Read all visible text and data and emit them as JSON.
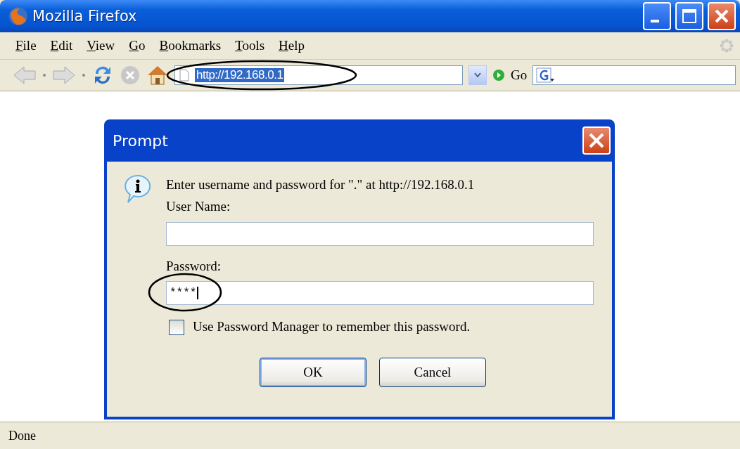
{
  "window": {
    "title": "Mozilla Firefox"
  },
  "menu": [
    {
      "label": "File"
    },
    {
      "label": "Edit"
    },
    {
      "label": "View"
    },
    {
      "label": "Go"
    },
    {
      "label": "Bookmarks"
    },
    {
      "label": "Tools"
    },
    {
      "label": "Help"
    }
  ],
  "toolbar": {
    "address": "http://192.168.0.1",
    "address_selected": true,
    "go": "Go"
  },
  "dialog": {
    "title": "Prompt",
    "message": "Enter username and password for \".\" at http://192.168.0.1",
    "fields": [
      {
        "label": "User Name:"
      },
      {
        "label": "Password:",
        "value": "****"
      }
    ],
    "checkbox": {
      "label": "Use Password Manager to remember this password.",
      "checked": false
    },
    "buttons": [
      {
        "label": "OK",
        "default": true
      },
      {
        "label": "Cancel",
        "default": false
      }
    ]
  },
  "status_bar": {
    "text": "Done"
  }
}
